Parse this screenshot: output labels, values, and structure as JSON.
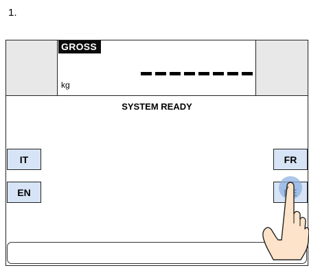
{
  "step": {
    "number": "1."
  },
  "display": {
    "mode_label": "GROSS",
    "unit": "kg",
    "weight_value": "▬▬▬▬▬▬▬▬"
  },
  "status": {
    "message": "SYSTEM READY"
  },
  "language_buttons": {
    "it": "IT",
    "en": "EN",
    "fr": "FR",
    "de": "DE"
  },
  "message_bar": {
    "text": ""
  },
  "colors": {
    "button_fill": "#d6e4f5",
    "header_panel_fill": "#e8e8e8",
    "gross_label_bg": "#0b0b0b",
    "touch_highlight": "#8fb3e0",
    "hand_skin": "#fce3c9"
  },
  "overlay": {
    "icon": "pointing-hand-icon",
    "target": "de"
  }
}
